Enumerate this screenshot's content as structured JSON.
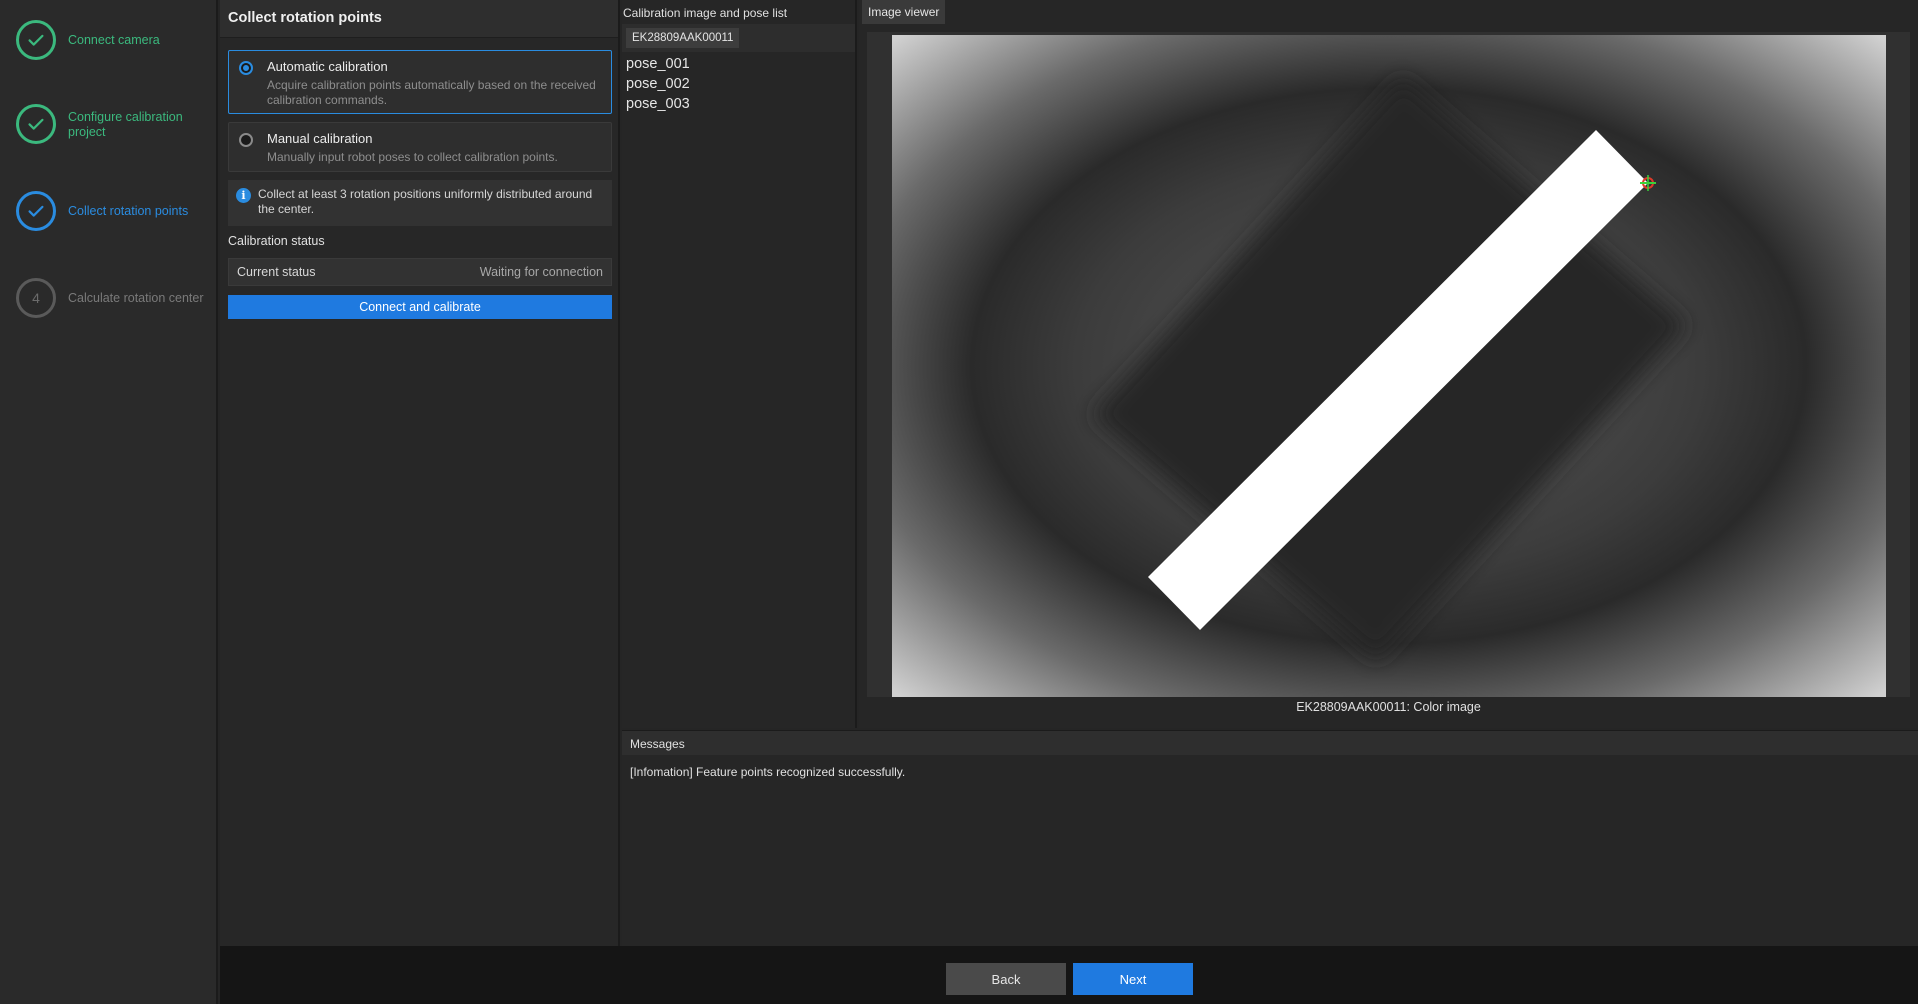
{
  "stepper": {
    "steps": [
      {
        "label": "Connect camera",
        "state": "done"
      },
      {
        "label": "Configure calibration project",
        "state": "done"
      },
      {
        "label": "Collect rotation points",
        "state": "active"
      },
      {
        "label": "Calculate rotation center",
        "state": "pending",
        "number": "4"
      }
    ]
  },
  "settings": {
    "title": "Collect rotation points",
    "auto": {
      "title": "Automatic calibration",
      "desc": "Acquire calibration points automatically based on the received calibration commands.",
      "selected": true
    },
    "manual": {
      "title": "Manual calibration",
      "desc": "Manually input robot poses to collect calibration points.",
      "selected": false
    },
    "info": "Collect at least 3 rotation positions uniformly distributed around the center.",
    "status_section": "Calibration status",
    "status_label": "Current status",
    "status_value": "Waiting for connection",
    "connect_button": "Connect and calibrate"
  },
  "pose_list": {
    "title": "Calibration image and pose list",
    "device": "EK28809AAK00011",
    "poses": [
      "pose_001",
      "pose_002",
      "pose_003"
    ]
  },
  "viewer": {
    "tab": "Image viewer",
    "caption": "EK28809AAK00011: Color image"
  },
  "messages": {
    "title": "Messages",
    "lines": [
      "[Infomation] Feature points recognized successfully."
    ]
  },
  "footer": {
    "back": "Back",
    "next": "Next"
  },
  "colors": {
    "done": "#3bb97e",
    "active": "#2a8ce0",
    "primary": "#1f7ae0"
  }
}
